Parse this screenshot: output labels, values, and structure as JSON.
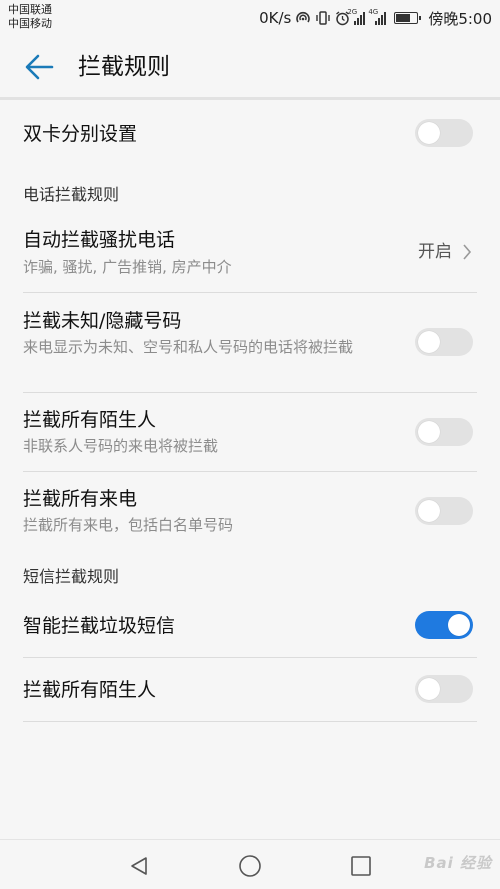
{
  "status_bar": {
    "carrier_1": "中国联通",
    "carrier_2": "中国移动",
    "speed": "0K/s",
    "network_tag_1": "2G",
    "network_tag_2": "4G",
    "time": "傍晚5:00"
  },
  "header": {
    "title": "拦截规则"
  },
  "dual_sim": {
    "label": "双卡分别设置",
    "enabled": false
  },
  "call_section": {
    "header": "电话拦截规则",
    "items": [
      {
        "title": "自动拦截骚扰电话",
        "subtitle": "诈骗, 骚扰, 广告推销, 房产中介",
        "value": "开启"
      },
      {
        "title": "拦截未知/隐藏号码",
        "subtitle": "来电显示为未知、空号和私人号码的电话将被拦截",
        "enabled": false
      },
      {
        "title": "拦截所有陌生人",
        "subtitle": "非联系人号码的来电将被拦截",
        "enabled": false
      },
      {
        "title": "拦截所有来电",
        "subtitle": "拦截所有来电，包括白名单号码",
        "enabled": false
      }
    ]
  },
  "sms_section": {
    "header": "短信拦截规则",
    "items": [
      {
        "title": "智能拦截垃圾短信",
        "enabled": true
      },
      {
        "title": "拦截所有陌生人",
        "enabled": false
      }
    ]
  },
  "watermark": "Bai 经验",
  "colors": {
    "accent": "#1f7ae0",
    "back_arrow": "#1a7ab8",
    "toggle_off": "#e2e2e2"
  }
}
